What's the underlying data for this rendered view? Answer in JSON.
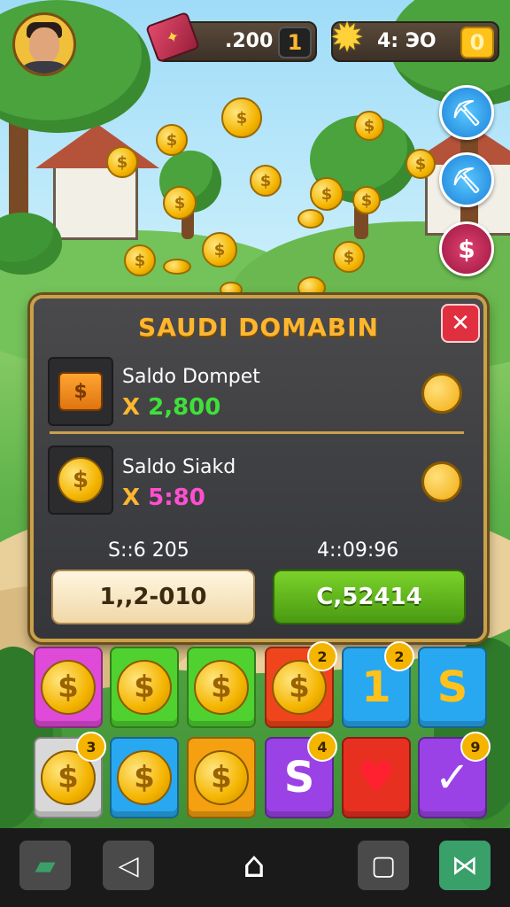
{
  "header": {
    "gems_value": ".200",
    "gems_badge": "1",
    "gold_value": "4: ЭО",
    "gold_badge": "0",
    "gem_symbol": "✦",
    "gold_icon": "star-badge-icon"
  },
  "side_buttons": [
    {
      "icon": "shovel-icon",
      "glyph": "⛏"
    },
    {
      "icon": "shovel-icon",
      "glyph": "⛏"
    },
    {
      "icon": "dollar-icon",
      "glyph": "$"
    }
  ],
  "dialog": {
    "title": "SAUDI DOMABIN",
    "close_label": "✕",
    "rows": [
      {
        "label": "Saldo Dompet",
        "x": "X",
        "amount": "2,800",
        "amount_color": "#3fe03a",
        "icon": "wallet-bag-icon",
        "glyph": "$"
      },
      {
        "label": "Saldo Siakd",
        "x": "X",
        "amount": "5:80",
        "amount_color": "#ff4fd0",
        "icon": "coin-icon",
        "glyph": "$"
      }
    ],
    "stat_left": "S::6 205",
    "stat_right": "4::09:96",
    "button_left": "1,,2-010",
    "button_right": "C,52414"
  },
  "tiles": [
    {
      "color": "#e04ad8",
      "kind": "coin",
      "glyph": "$",
      "badge": ""
    },
    {
      "color": "#4fd12f",
      "kind": "coin",
      "glyph": "$",
      "badge": ""
    },
    {
      "color": "#4fd12f",
      "kind": "coin",
      "glyph": "$",
      "badge": ""
    },
    {
      "color": "#f0451c",
      "kind": "coin",
      "glyph": "$",
      "badge": "2"
    },
    {
      "color": "#28a8f0",
      "kind": "glyph",
      "glyph": "1",
      "glyph_color": "#ffc21a",
      "badge": "2"
    },
    {
      "color": "#28a8f0",
      "kind": "glyph",
      "glyph": "S",
      "glyph_color": "#ffc21a",
      "badge": ""
    },
    {
      "color": "#d8d8d8",
      "kind": "coin",
      "glyph": "$",
      "badge": "3"
    },
    {
      "color": "#28a8f0",
      "kind": "coin",
      "glyph": "$",
      "badge": ""
    },
    {
      "color": "#f4a010",
      "kind": "coin",
      "glyph": "$",
      "badge": ""
    },
    {
      "color": "#9a42e6",
      "kind": "glyph",
      "glyph": "S",
      "glyph_color": "#ffffff",
      "badge": "4"
    },
    {
      "color": "#e83020",
      "kind": "glyph",
      "glyph": "♥",
      "glyph_color": "#ff2030",
      "badge": ""
    },
    {
      "color": "#9a42e6",
      "kind": "glyph",
      "glyph": "✓",
      "glyph_color": "#ffffff",
      "badge": "9"
    }
  ],
  "nav": [
    {
      "icon": "map-icon",
      "glyph": "▰"
    },
    {
      "icon": "back-icon",
      "glyph": "◁"
    },
    {
      "icon": "home-icon",
      "glyph": "⌂"
    },
    {
      "icon": "recents-icon",
      "glyph": "▢"
    },
    {
      "icon": "shuffle-icon",
      "glyph": "⋈"
    }
  ]
}
